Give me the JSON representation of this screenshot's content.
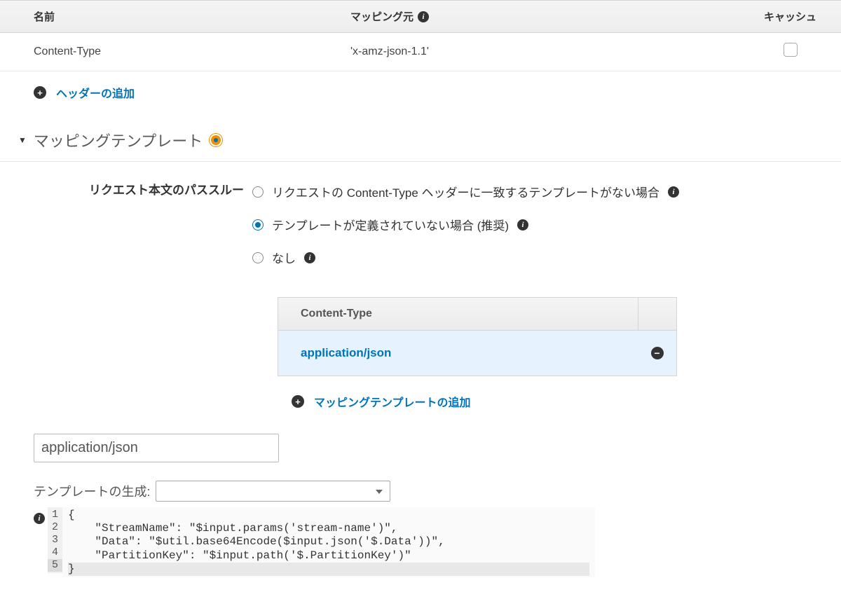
{
  "headers_table": {
    "columns": {
      "name": "名前",
      "source": "マッピング元",
      "cache": "キャッシュ"
    },
    "rows": [
      {
        "name": "Content-Type",
        "source": "'x-amz-json-1.1'",
        "cached": false
      }
    ],
    "add_label": "ヘッダーの追加"
  },
  "mapping_templates": {
    "title": "マッピングテンプレート",
    "passthrough_label": "リクエスト本文のパススルー",
    "options": [
      {
        "label": "リクエストの Content-Type ヘッダーに一致するテンプレートがない場合",
        "checked": false
      },
      {
        "label": "テンプレートが定義されていない場合 (推奨)",
        "checked": true
      },
      {
        "label": "なし",
        "checked": false
      }
    ],
    "content_type_header": "Content-Type",
    "content_type_value": "application/json",
    "add_template_label": "マッピングテンプレートの追加"
  },
  "editor": {
    "input_value": "application/json",
    "generate_label": "テンプレートの生成:",
    "lines": [
      "{",
      "    \"StreamName\": \"$input.params('stream-name')\",",
      "    \"Data\": \"$util.base64Encode($input.json('$.Data'))\",",
      "    \"PartitionKey\": \"$input.path('$.PartitionKey')\"",
      "}"
    ]
  }
}
